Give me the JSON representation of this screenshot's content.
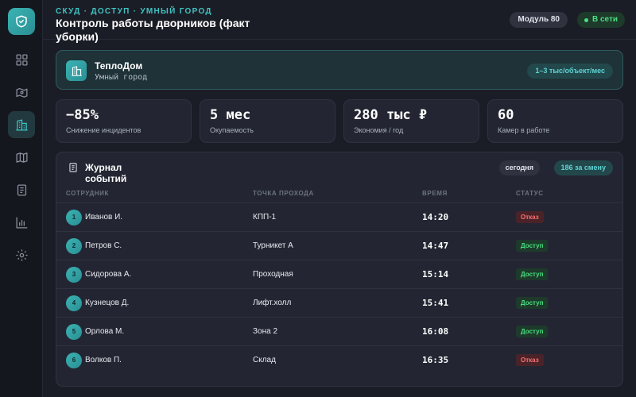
{
  "header": {
    "breadcrumb": "СКУД · ДОСТУП · УМНЫЙ ГОРОД",
    "title": "Контроль работы дворников (факт уборки)",
    "module": "Модуль 80",
    "status": "В сети"
  },
  "sidebar": {
    "logo_icon": "shield-check-icon",
    "items": [
      {
        "icon": "dashboard-icon",
        "active": false
      },
      {
        "icon": "map-route-icon",
        "active": false
      },
      {
        "icon": "building-icon",
        "active": true
      },
      {
        "icon": "map-icon",
        "active": false
      },
      {
        "icon": "document-icon",
        "active": false
      },
      {
        "icon": "chart-icon",
        "active": false
      },
      {
        "icon": "gear-icon",
        "active": false
      }
    ]
  },
  "company": {
    "name": "ТеплоДом",
    "subtitle": "Умный город",
    "price": "1–3 тыс/объект/мес"
  },
  "kpis": [
    {
      "value": "−85%",
      "label": "Снижение инцидентов"
    },
    {
      "value": "5 мес",
      "label": "Окупаемость"
    },
    {
      "value": "280 тыс ₽",
      "label": "Экономия / год"
    },
    {
      "value": "60",
      "label": "Камер в работе"
    }
  ],
  "events": {
    "title": "Журнал событий",
    "period": "сегодня",
    "count": "186 за смену",
    "columns": [
      "СОТРУДНИК",
      "ТОЧКА ПРОХОДА",
      "ВРЕМЯ",
      "СТАТУС"
    ],
    "rows": [
      {
        "num": "1",
        "name": "Иванов И.",
        "point": "КПП-1",
        "time": "14:20",
        "status": "Отказ",
        "kind": "deny"
      },
      {
        "num": "2",
        "name": "Петров С.",
        "point": "Турникет А",
        "time": "14:47",
        "status": "Доступ",
        "kind": "ok"
      },
      {
        "num": "3",
        "name": "Сидорова А.",
        "point": "Проходная",
        "time": "15:14",
        "status": "Доступ",
        "kind": "ok"
      },
      {
        "num": "4",
        "name": "Кузнецов Д.",
        "point": "Лифт.холл",
        "time": "15:41",
        "status": "Доступ",
        "kind": "ok"
      },
      {
        "num": "5",
        "name": "Орлова М.",
        "point": "Зона 2",
        "time": "16:08",
        "status": "Доступ",
        "kind": "ok"
      },
      {
        "num": "6",
        "name": "Волков П.",
        "point": "Склад",
        "time": "16:35",
        "status": "Отказ",
        "kind": "deny"
      }
    ]
  },
  "colors": {
    "accent": "#3fc2c2",
    "success": "#4ade80",
    "danger": "#f87171",
    "background": "#1b1d26"
  }
}
